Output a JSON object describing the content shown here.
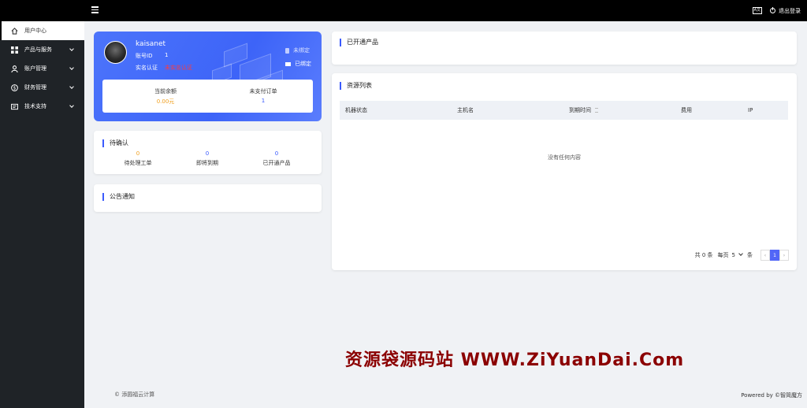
{
  "topbar": {
    "lang_icon_text": "A文",
    "logout_label": "退出登录"
  },
  "sidebar": {
    "items": [
      {
        "label": "用户中心",
        "icon": "home-icon"
      },
      {
        "label": "产品与服务",
        "icon": "grid-icon"
      },
      {
        "label": "账户管理",
        "icon": "user-icon"
      },
      {
        "label": "财务管理",
        "icon": "dollar-icon"
      },
      {
        "label": "技术支持",
        "icon": "ticket-icon"
      }
    ]
  },
  "profile": {
    "username": "kaisanet",
    "account_id_label": "账号ID",
    "account_id": "1",
    "verify_label": "实名认证",
    "verify_status": "未实名认证",
    "phone_bind": "未绑定",
    "email_bind": "已绑定",
    "balance_label": "当前余额",
    "balance_value": "0.00元",
    "unpaid_label": "未支付订单",
    "unpaid_value": "1"
  },
  "todo": {
    "title": "待确认",
    "items": [
      {
        "value": "0",
        "label": "待处理工单"
      },
      {
        "value": "0",
        "label": "即将到期"
      },
      {
        "value": "0",
        "label": "已开通产品"
      }
    ]
  },
  "notice": {
    "title": "公告通知"
  },
  "opened": {
    "title": "已开通产品"
  },
  "resources": {
    "title": "资源列表",
    "columns": [
      "机器状态",
      "主机名",
      "到期时间",
      "费用",
      "IP"
    ],
    "empty_text": "没有任何内容",
    "pager": {
      "total": "共 0 条",
      "per_page_label": "每页",
      "per_page_value": "5",
      "per_page_unit": "条",
      "prev": "‹",
      "current": "1",
      "next": "›"
    }
  },
  "footer": {
    "copyright": "© 添圆福云计算",
    "powered": "Powered by ©智简魔方"
  },
  "watermark": "资源袋源码站  WWW.ZiYuanDai.Com",
  "colors": {
    "accent": "#3b5bfd",
    "sidebar_bg": "#1f2327",
    "topbar_bg": "#000000",
    "warn": "#ff3b3b",
    "balance": "#f0a020"
  }
}
